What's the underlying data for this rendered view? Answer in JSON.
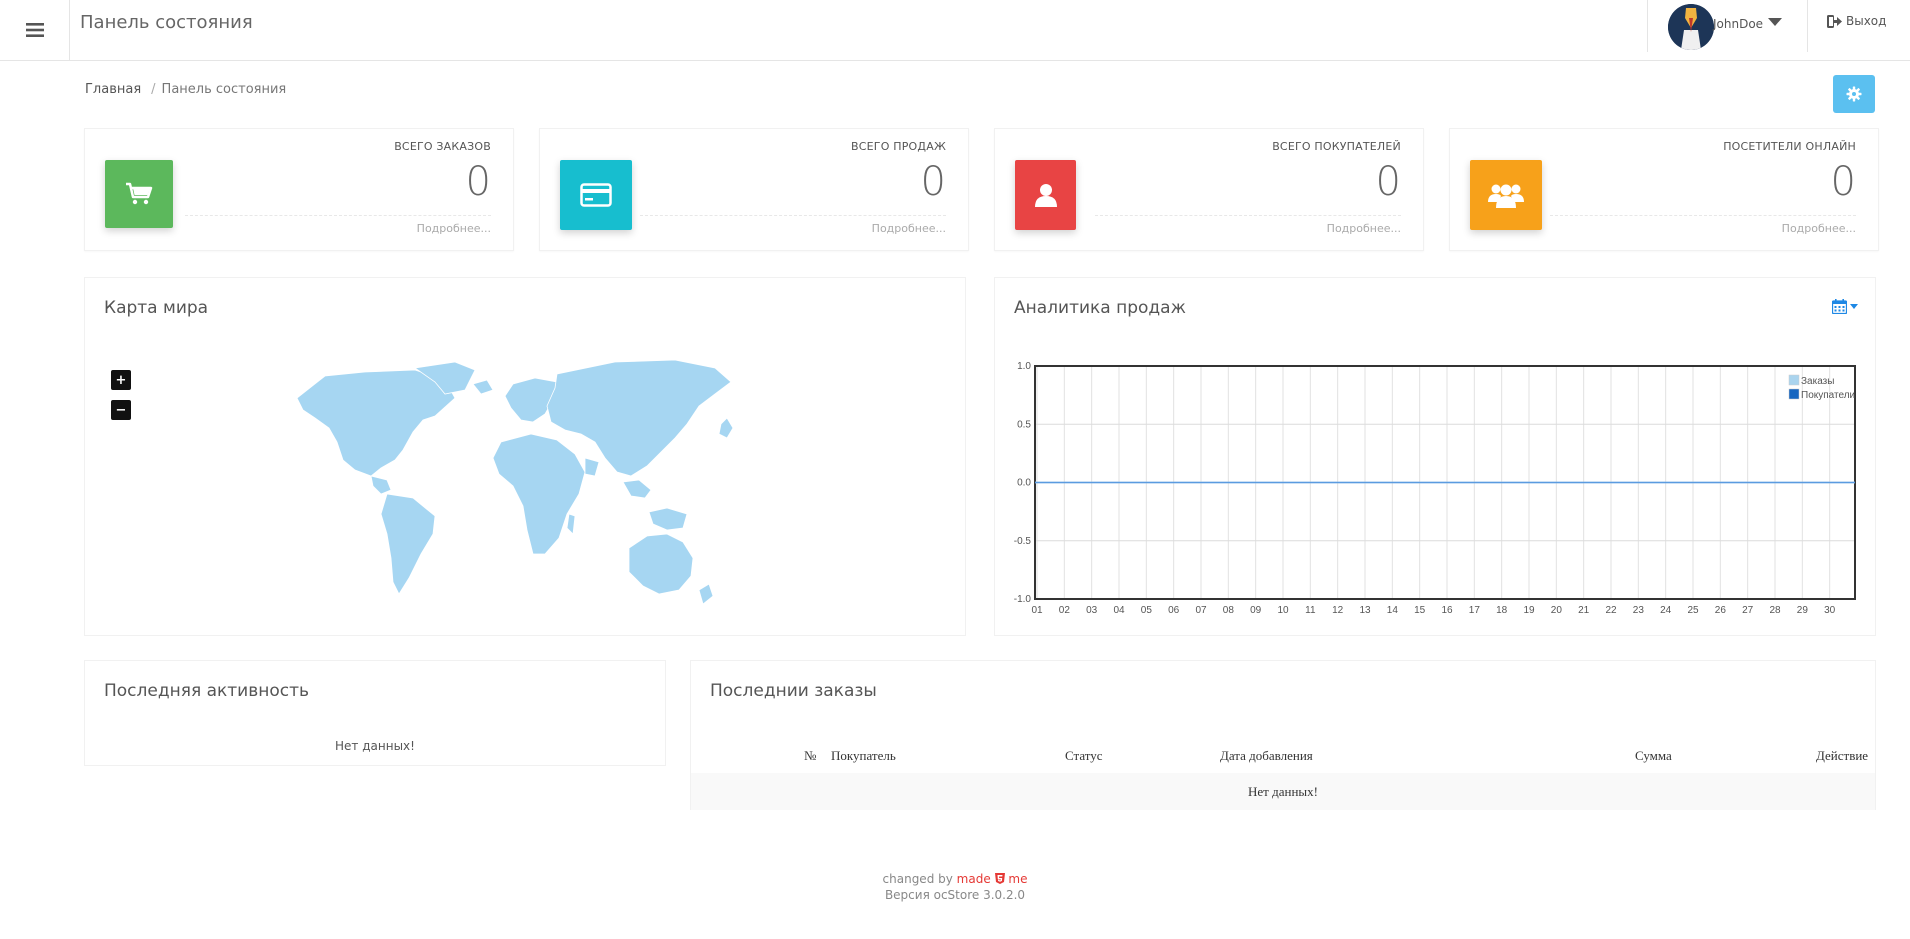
{
  "header": {
    "title": "Панель состояния",
    "user_name": "JohnDoe",
    "logout_label": "Выход"
  },
  "breadcrumb": {
    "home": "Главная",
    "current": "Панель состояния"
  },
  "tiles": [
    {
      "label": "ВСЕГО ЗАКАЗОВ",
      "value": "0",
      "more": "Подробнее...",
      "color": "#5cb85c",
      "icon": "shopping-cart-icon"
    },
    {
      "label": "ВСЕГО ПРОДАЖ",
      "value": "0",
      "more": "Подробнее...",
      "color": "#17becf",
      "icon": "credit-card-icon"
    },
    {
      "label": "ВСЕГО ПОКУПАТЕЛЕЙ",
      "value": "0",
      "more": "Подробнее...",
      "color": "#e84444",
      "icon": "user-icon"
    },
    {
      "label": "ПОСЕТИТЕЛИ ОНЛАЙН",
      "value": "0",
      "more": "Подробнее...",
      "color": "#f7a11a",
      "icon": "users-icon"
    }
  ],
  "map_panel": {
    "title": "Карта мира",
    "zoom_in": "+",
    "zoom_out": "−",
    "color": "#a6d6f2"
  },
  "analytics_panel": {
    "title": "Аналитика продаж"
  },
  "chart_data": {
    "type": "line",
    "x": [
      "01",
      "02",
      "03",
      "04",
      "05",
      "06",
      "07",
      "08",
      "09",
      "10",
      "11",
      "12",
      "13",
      "14",
      "15",
      "16",
      "17",
      "18",
      "19",
      "20",
      "21",
      "22",
      "23",
      "24",
      "25",
      "26",
      "27",
      "28",
      "29",
      "30"
    ],
    "series": [
      {
        "name": "Заказы",
        "color": "#aad4ee",
        "values": [
          0,
          0,
          0,
          0,
          0,
          0,
          0,
          0,
          0,
          0,
          0,
          0,
          0,
          0,
          0,
          0,
          0,
          0,
          0,
          0,
          0,
          0,
          0,
          0,
          0,
          0,
          0,
          0,
          0,
          0
        ]
      },
      {
        "name": "Покупатели",
        "color": "#1565c0",
        "values": [
          0,
          0,
          0,
          0,
          0,
          0,
          0,
          0,
          0,
          0,
          0,
          0,
          0,
          0,
          0,
          0,
          0,
          0,
          0,
          0,
          0,
          0,
          0,
          0,
          0,
          0,
          0,
          0,
          0,
          0
        ]
      }
    ],
    "yticks": [
      "1.0",
      "0.5",
      "0.0",
      "-0.5",
      "-1.0"
    ],
    "ylim": [
      -1,
      1
    ],
    "grid": true,
    "legend": "top-right",
    "title": "",
    "xlabel": "",
    "ylabel": ""
  },
  "activity_panel": {
    "title": "Последняя активность",
    "empty": "Нет данных!"
  },
  "orders_panel": {
    "title": "Последнии заказы",
    "columns": {
      "num": "№",
      "customer": "Покупатель",
      "status": "Статус",
      "date": "Дата добавления",
      "total": "Сумма",
      "action": "Действие"
    },
    "empty": "Нет данных!"
  },
  "footer": {
    "changed_by": "changed by",
    "made": "made",
    "me": "me",
    "version": "Версия ocStore 3.0.2.0"
  }
}
